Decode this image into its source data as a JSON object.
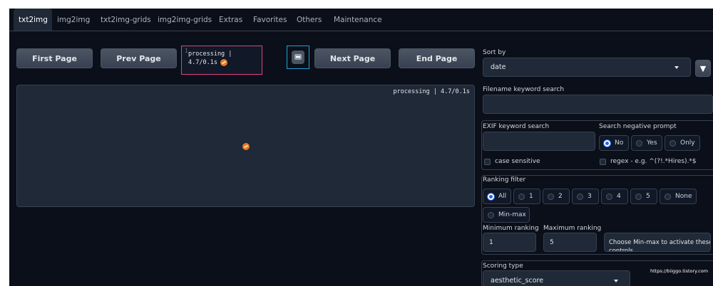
{
  "tabs": [
    "txt2img",
    "img2img",
    "txt2img-grids",
    "img2img-grids",
    "Extras",
    "Favorites",
    "Others",
    "Maintenance"
  ],
  "pager": {
    "first": "First Page",
    "prev": "Prev Page",
    "next": "Next Page",
    "end": "End Page",
    "page_value": "1",
    "status_line1": "processing |",
    "status_line2": "4.7/0.1s"
  },
  "gallery": {
    "status": "processing | 4.7/0.1s"
  },
  "sort": {
    "label": "Sort by",
    "value": "date",
    "direction_icon": "▼"
  },
  "filename_search": {
    "label": "Filename keyword search",
    "value": ""
  },
  "exif_search": {
    "label": "EXIF keyword search",
    "value": ""
  },
  "negative_prompt": {
    "label": "Search negative prompt",
    "options": [
      "No",
      "Yes",
      "Only"
    ],
    "selected": "No"
  },
  "case_sensitive": {
    "label": "case sensitive",
    "checked": false
  },
  "regex": {
    "label": "regex - e.g. ^(?!.*Hires).*$",
    "checked": false
  },
  "ranking_filter": {
    "label": "Ranking filter",
    "options": [
      "All",
      "1",
      "2",
      "3",
      "4",
      "5",
      "None",
      "Min-max"
    ],
    "selected": "All"
  },
  "min_ranking": {
    "label": "Minimum ranking",
    "value": "1"
  },
  "max_ranking": {
    "label": "Maximum ranking",
    "value": "5"
  },
  "minmax_note": {
    "line1": "Choose Min-max to activate these",
    "line2": "controls"
  },
  "scoring": {
    "label": "Scoring type",
    "value": "aesthetic_score"
  },
  "watermark": "https://biiggo.tistory.com",
  "colors": {
    "background": "#0b0f19",
    "panel": "#1f2937",
    "border": "#374151",
    "accent_blue": "#2563eb",
    "highlight_pink": "#e0408a",
    "highlight_cyan": "#1fa2d6"
  }
}
